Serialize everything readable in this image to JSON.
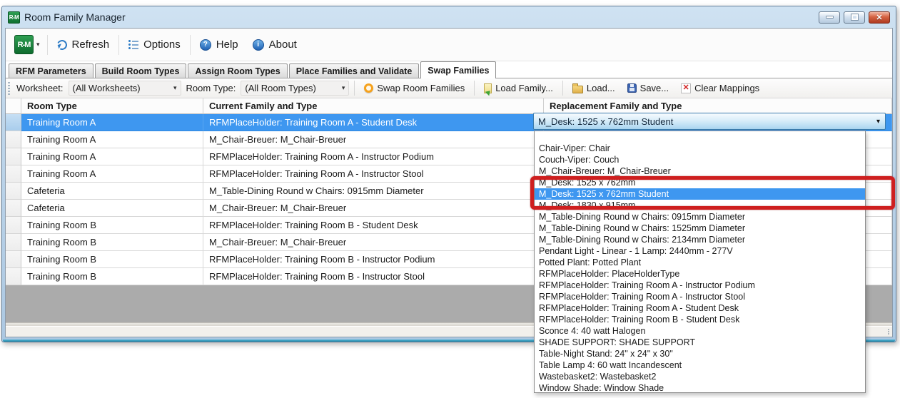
{
  "titlebar": {
    "title": "Room Family Manager",
    "logo": "R-M"
  },
  "icons": {
    "dropdown_arrow": "▾",
    "close": "✕",
    "help": "?",
    "about": "i"
  },
  "menubar": {
    "refresh": "Refresh",
    "options": "Options",
    "help": "Help",
    "about": "About"
  },
  "tabs": [
    {
      "label": "RFM Parameters"
    },
    {
      "label": "Build Room Types"
    },
    {
      "label": "Assign Room Types"
    },
    {
      "label": "Place Families and Validate"
    },
    {
      "label": "Swap Families",
      "state": "active"
    }
  ],
  "filterbar": {
    "worksheet_label": "Worksheet:",
    "worksheet_value": "(All Worksheets)",
    "room_type_label": "Room Type:",
    "room_type_value": "(All Room Types)",
    "swap_button": "Swap Room Families",
    "load_family_button": "Load Family...",
    "load_button": "Load...",
    "save_button": "Save...",
    "clear_button": "Clear Mappings"
  },
  "grid": {
    "columns": [
      "Room Type",
      "Current Family and Type",
      "Replacement Family and Type"
    ],
    "rows": [
      {
        "room_type": "Training Room A",
        "current": "RFMPlaceHolder: Training Room A - Student Desk",
        "state": "selected"
      },
      {
        "room_type": "Training Room A",
        "current": "M_Chair-Breuer: M_Chair-Breuer"
      },
      {
        "room_type": "Training Room A",
        "current": "RFMPlaceHolder: Training Room A - Instructor Podium"
      },
      {
        "room_type": "Training Room A",
        "current": "RFMPlaceHolder: Training Room A - Instructor Stool"
      },
      {
        "room_type": "Cafeteria",
        "current": "M_Table-Dining Round w Chairs: 0915mm Diameter"
      },
      {
        "room_type": "Cafeteria",
        "current": "M_Chair-Breuer: M_Chair-Breuer"
      },
      {
        "room_type": "Training Room B",
        "current": "RFMPlaceHolder: Training Room B - Student Desk"
      },
      {
        "room_type": "Training Room B",
        "current": "M_Chair-Breuer: M_Chair-Breuer"
      },
      {
        "room_type": "Training Room B",
        "current": "RFMPlaceHolder: Training Room B - Instructor Podium"
      },
      {
        "room_type": "Training Room B",
        "current": "RFMPlaceHolder: Training Room B - Instructor Stool"
      }
    ]
  },
  "replacement_combo": {
    "value": "M_Desk: 1525 x 762mm Student"
  },
  "dropdown": {
    "items": [
      {
        "label": ""
      },
      {
        "label": "Chair-Viper: Chair"
      },
      {
        "label": "Couch-Viper: Couch"
      },
      {
        "label": "M_Chair-Breuer: M_Chair-Breuer"
      },
      {
        "label": "M_Desk: 1525 x 762mm"
      },
      {
        "label": "M_Desk: 1525 x 762mm Student",
        "state": "selected"
      },
      {
        "label": "M_Desk: 1830 x 915mm"
      },
      {
        "label": "M_Table-Dining Round w Chairs: 0915mm Diameter"
      },
      {
        "label": "M_Table-Dining Round w Chairs: 1525mm Diameter"
      },
      {
        "label": "M_Table-Dining Round w Chairs: 2134mm Diameter"
      },
      {
        "label": "Pendant Light - Linear - 1 Lamp: 2440mm - 277V"
      },
      {
        "label": "Potted Plant: Potted Plant"
      },
      {
        "label": "RFMPlaceHolder: PlaceHolderType"
      },
      {
        "label": "RFMPlaceHolder: Training Room A - Instructor Podium"
      },
      {
        "label": "RFMPlaceHolder: Training Room A - Instructor Stool"
      },
      {
        "label": "RFMPlaceHolder: Training Room A - Student Desk"
      },
      {
        "label": "RFMPlaceHolder: Training Room B - Student Desk"
      },
      {
        "label": "Sconce 4: 40 watt Halogen"
      },
      {
        "label": "SHADE SUPPORT: SHADE SUPPORT"
      },
      {
        "label": "Table-Night Stand: 24\" x 24\" x 30\""
      },
      {
        "label": "Table Lamp 4: 60 watt Incandescent"
      },
      {
        "label": "Wastebasket2: Wastebasket2"
      },
      {
        "label": "Window Shade: Window Shade"
      }
    ]
  },
  "colors": {
    "selection_blue": "#3E97F0",
    "annotation_red": "#CE1F1F",
    "logo_green": "#0F7030",
    "titlebar_blue": "#C0D7EB"
  }
}
